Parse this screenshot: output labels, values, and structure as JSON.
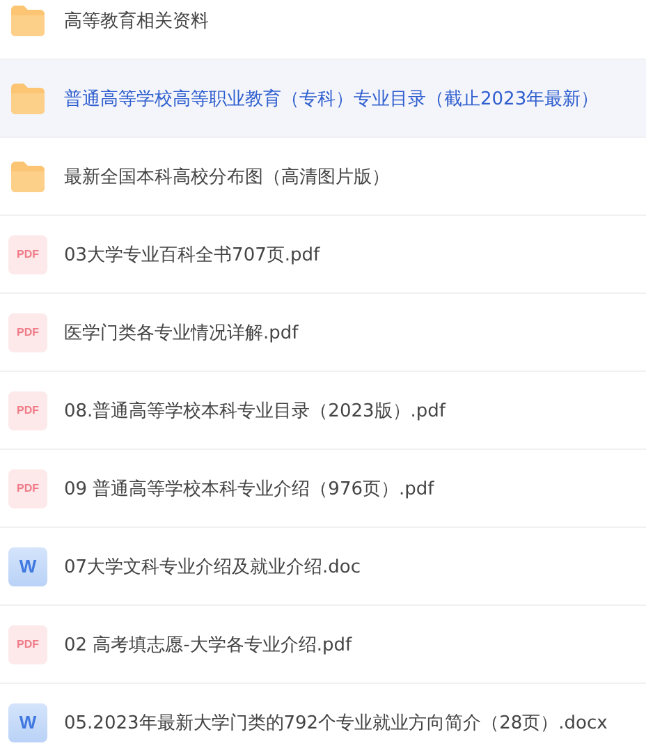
{
  "files": [
    {
      "kind": "folder",
      "name": "高等教育相关资料",
      "selected": false
    },
    {
      "kind": "folder",
      "name": "普通高等学校高等职业教育（专科）专业目录（截止2023年最新）",
      "selected": true
    },
    {
      "kind": "folder",
      "name": "最新全国本科高校分布图（高清图片版）",
      "selected": false
    },
    {
      "kind": "pdf",
      "name": "03大学专业百科全书707页.pdf",
      "badge": "PDF",
      "selected": false
    },
    {
      "kind": "pdf",
      "name": "医学门类各专业情况详解.pdf",
      "badge": "PDF",
      "selected": false
    },
    {
      "kind": "pdf",
      "name": "08.普通高等学校本科专业目录（2023版）.pdf",
      "badge": "PDF",
      "selected": false
    },
    {
      "kind": "pdf",
      "name": "09 普通高等学校本科专业介绍（976页）.pdf",
      "badge": "PDF",
      "selected": false
    },
    {
      "kind": "word",
      "name": "07大学文科专业介绍及就业介绍.doc",
      "badge": "W",
      "selected": false
    },
    {
      "kind": "pdf",
      "name": "02 高考填志愿-大学各专业介绍.pdf",
      "badge": "PDF",
      "selected": false
    },
    {
      "kind": "word",
      "name": "05.2023年最新大学门类的792个专业就业方向简介（28页）.docx",
      "badge": "W",
      "selected": false
    }
  ]
}
